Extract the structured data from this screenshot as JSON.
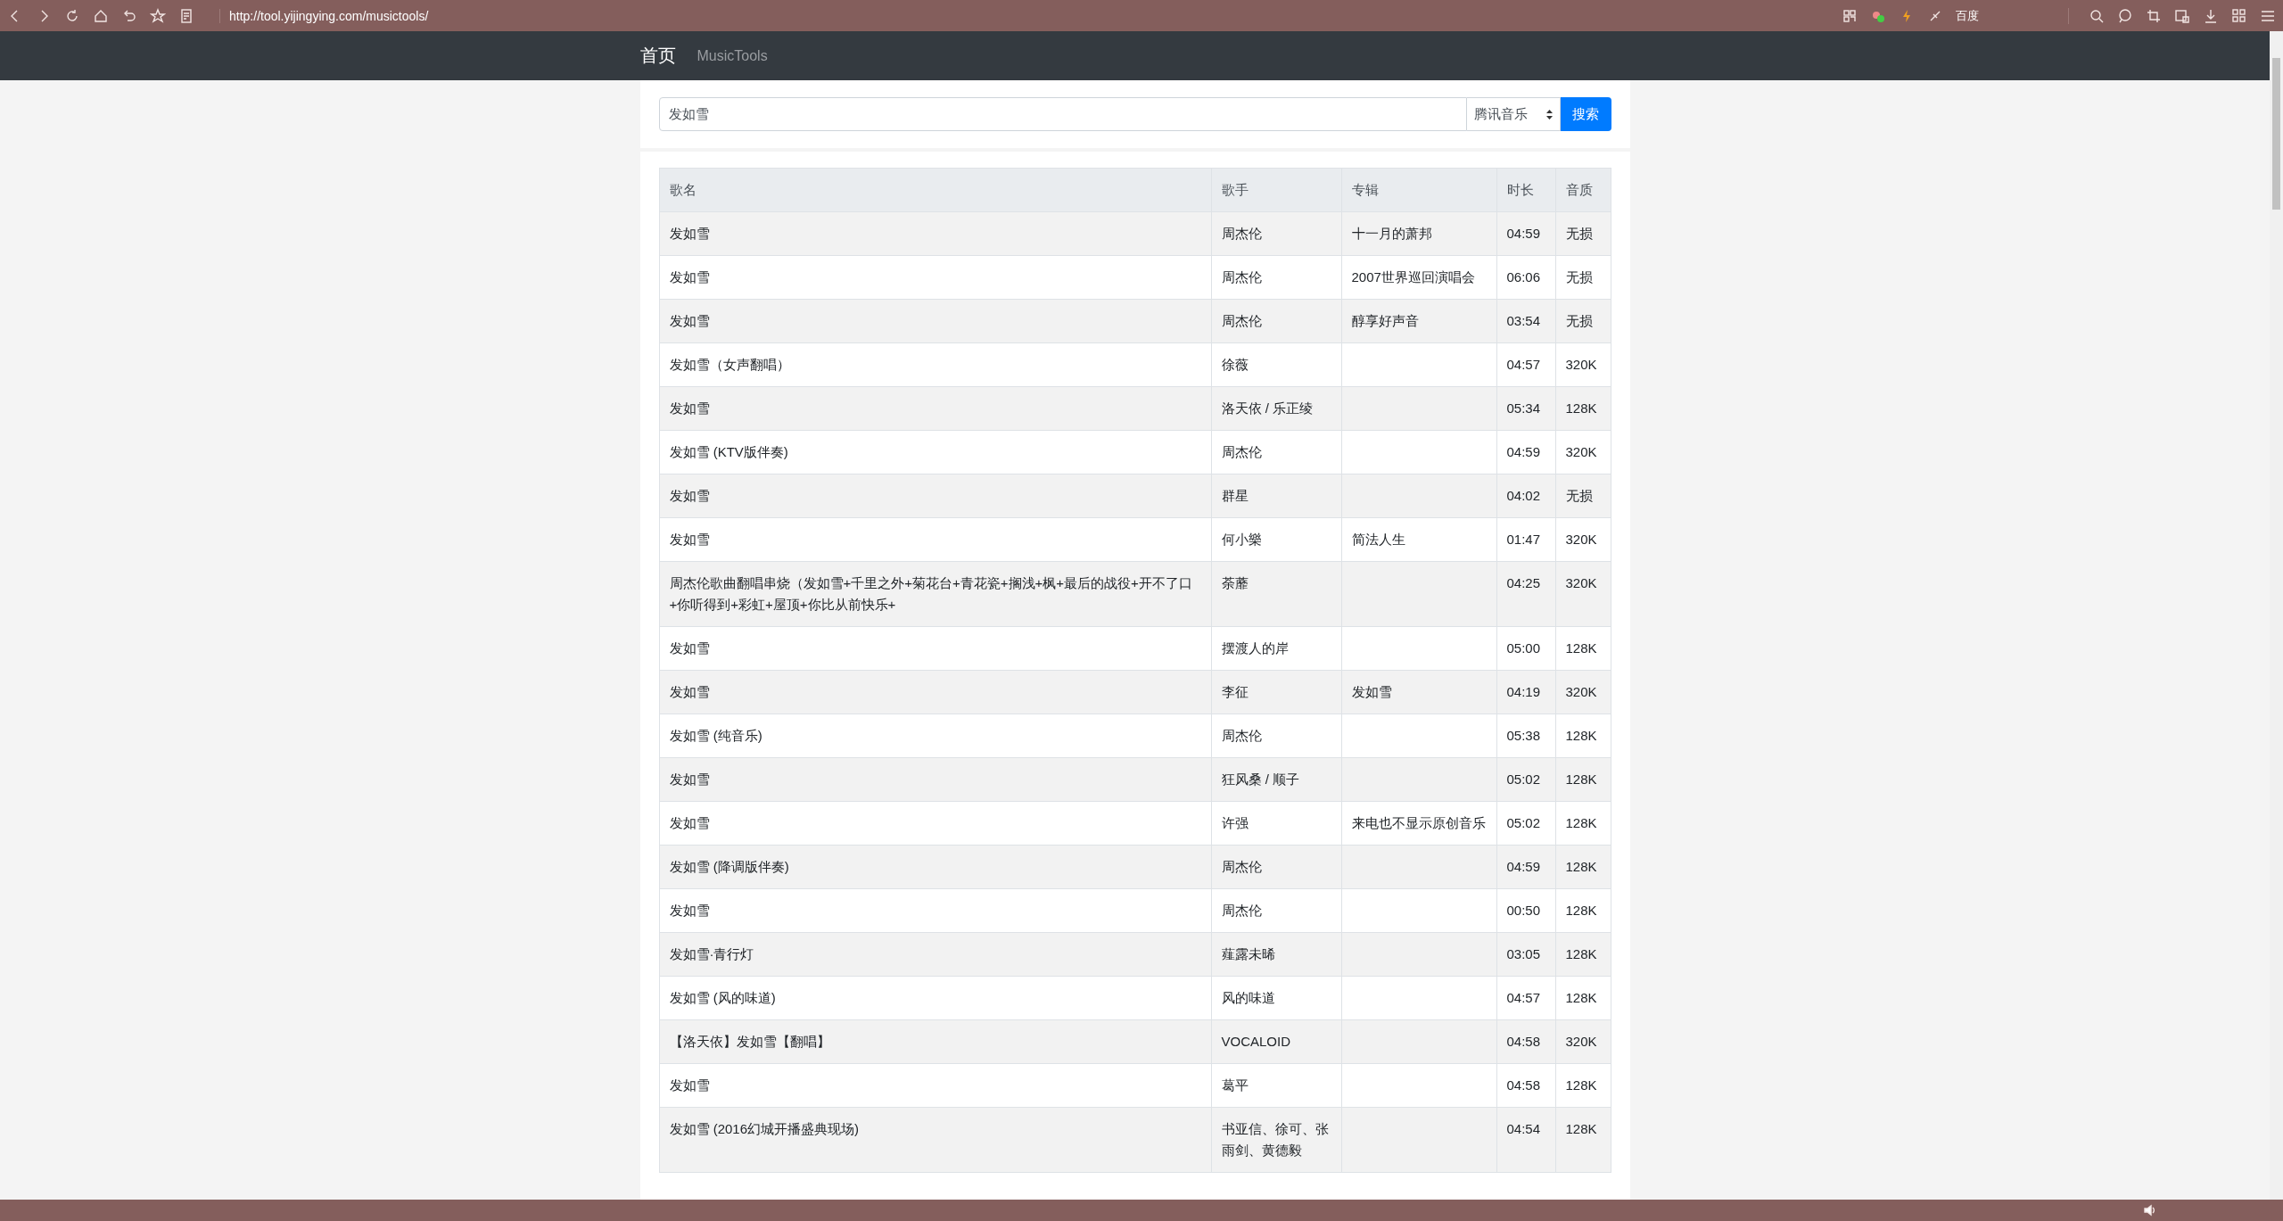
{
  "browser": {
    "url": "http://tool.yijingying.com/musictools/",
    "search_engine": "百度"
  },
  "nav": {
    "brand": "首页",
    "link": "MusicTools"
  },
  "search": {
    "value": "发如雪",
    "source": "腾讯音乐",
    "button": "搜索"
  },
  "table": {
    "columns": [
      "歌名",
      "歌手",
      "专辑",
      "时长",
      "音质"
    ],
    "rows": [
      {
        "song": "发如雪",
        "artist": "周杰伦",
        "album": "十一月的萧邦",
        "duration": "04:59",
        "quality": "无损"
      },
      {
        "song": "发如雪",
        "artist": "周杰伦",
        "album": "2007世界巡回演唱会",
        "duration": "06:06",
        "quality": "无损"
      },
      {
        "song": "发如雪",
        "artist": "周杰伦",
        "album": "醇享好声音",
        "duration": "03:54",
        "quality": "无损"
      },
      {
        "song": "发如雪（女声翻唱）",
        "artist": "徐薇",
        "duration": "04:57",
        "quality": "320K"
      },
      {
        "song": "发如雪",
        "artist": "洛天依 / 乐正绫",
        "duration": "05:34",
        "quality": "128K"
      },
      {
        "song": "发如雪 (KTV版伴奏)",
        "artist": "周杰伦",
        "duration": "04:59",
        "quality": "320K"
      },
      {
        "song": "发如雪",
        "artist": "群星",
        "duration": "04:02",
        "quality": "无损"
      },
      {
        "song": "发如雪",
        "artist": "何小樂",
        "album": "简法人生",
        "duration": "01:47",
        "quality": "320K"
      },
      {
        "song": "周杰伦歌曲翻唱串烧（发如雪+千里之外+菊花台+青花瓷+搁浅+枫+最后的战役+开不了口+你听得到+彩虹+屋顶+你比从前快乐+",
        "artist": "荼蘼",
        "duration": "04:25",
        "quality": "320K"
      },
      {
        "song": "发如雪",
        "artist": "摆渡人的岸",
        "duration": "05:00",
        "quality": "128K"
      },
      {
        "song": "发如雪",
        "artist": "李征",
        "album": "发如雪",
        "duration": "04:19",
        "quality": "320K"
      },
      {
        "song": "发如雪 (纯音乐)",
        "artist": "周杰伦",
        "duration": "05:38",
        "quality": "128K"
      },
      {
        "song": "发如雪",
        "artist": "狂风桑 / 顺子",
        "duration": "05:02",
        "quality": "128K"
      },
      {
        "song": "发如雪",
        "artist": "许强",
        "album": "来电也不显示原创音乐",
        "duration": "05:02",
        "quality": "128K"
      },
      {
        "song": "发如雪 (降调版伴奏)",
        "artist": "周杰伦",
        "duration": "04:59",
        "quality": "128K"
      },
      {
        "song": "发如雪",
        "artist": "周杰伦",
        "duration": "00:50",
        "quality": "128K"
      },
      {
        "song": "发如雪·青行灯",
        "artist": "薤露未晞",
        "duration": "03:05",
        "quality": "128K"
      },
      {
        "song": "发如雪 (风的味道)",
        "artist": "风的味道",
        "duration": "04:57",
        "quality": "128K"
      },
      {
        "song": "【洛天依】发如雪【翻唱】",
        "artist": "VOCALOID",
        "duration": "04:58",
        "quality": "320K"
      },
      {
        "song": "发如雪",
        "artist": "葛平",
        "duration": "04:58",
        "quality": "128K"
      },
      {
        "song": "发如雪 (2016幻城开播盛典现场)",
        "artist": "书亚信、徐可、张雨剑、黄德毅",
        "duration": "04:54",
        "quality": "128K"
      }
    ]
  }
}
